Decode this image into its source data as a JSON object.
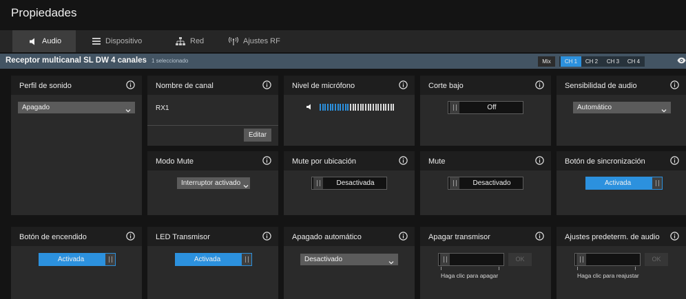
{
  "window": {
    "title": "Propiedades"
  },
  "tabs": [
    {
      "label": "Audio",
      "icon": "speaker-icon",
      "active": true
    },
    {
      "label": "Dispositivo",
      "icon": "list-icon",
      "active": false
    },
    {
      "label": "Red",
      "icon": "network-icon",
      "active": false
    },
    {
      "label": "Ajustes RF",
      "icon": "antenna-icon",
      "active": false
    }
  ],
  "device": {
    "name": "Receptor multicanal SL DW 4 canales",
    "selection": "1 seleccionado",
    "mix_label": "Mix",
    "channels": [
      {
        "label": "CH 1",
        "active": true
      },
      {
        "label": "CH 2",
        "active": false
      },
      {
        "label": "CH 3",
        "active": false
      },
      {
        "label": "CH 4",
        "active": false
      }
    ]
  },
  "cards": {
    "sound_profile": {
      "title": "Perfil de sonido",
      "value": "Apagado"
    },
    "channel_name": {
      "title": "Nombre de canal",
      "value": "RX1",
      "edit_label": "Editar"
    },
    "mic_level": {
      "title": "Nivel de micrófono",
      "level_fraction": 0.4,
      "segments": 30
    },
    "low_cut": {
      "title": "Corte bajo",
      "value": "Off"
    },
    "audio_sensitivity": {
      "title": "Sensibilidad de audio",
      "value": "Automático"
    },
    "mute_mode": {
      "title": "Modo Mute",
      "value": "Interruptor activado"
    },
    "location_mute": {
      "title": "Mute por ubicación",
      "value": "Desactivada"
    },
    "mute": {
      "title": "Mute",
      "value": "Desactivado"
    },
    "sync_button": {
      "title": "Botón de sincronización",
      "value": "Activada"
    },
    "power_button": {
      "title": "Botón de encendido",
      "value": "Activada"
    },
    "led_transmitter": {
      "title": "LED Transmisor",
      "value": "Activada"
    },
    "auto_off": {
      "title": "Apagado automático",
      "value": "Desactivado"
    },
    "transmitter_off": {
      "title": "Apagar transmisor",
      "ok_label": "OK",
      "hint": "Haga clic para apagar"
    },
    "audio_presets": {
      "title": "Ajustes predeterm. de audio",
      "ok_label": "OK",
      "hint": "Haga clic para reajustar"
    }
  },
  "colors": {
    "accent": "#2c91de",
    "subbar": "#435463",
    "card": "#2a2a2a",
    "card_header": "#1e1e1e"
  }
}
